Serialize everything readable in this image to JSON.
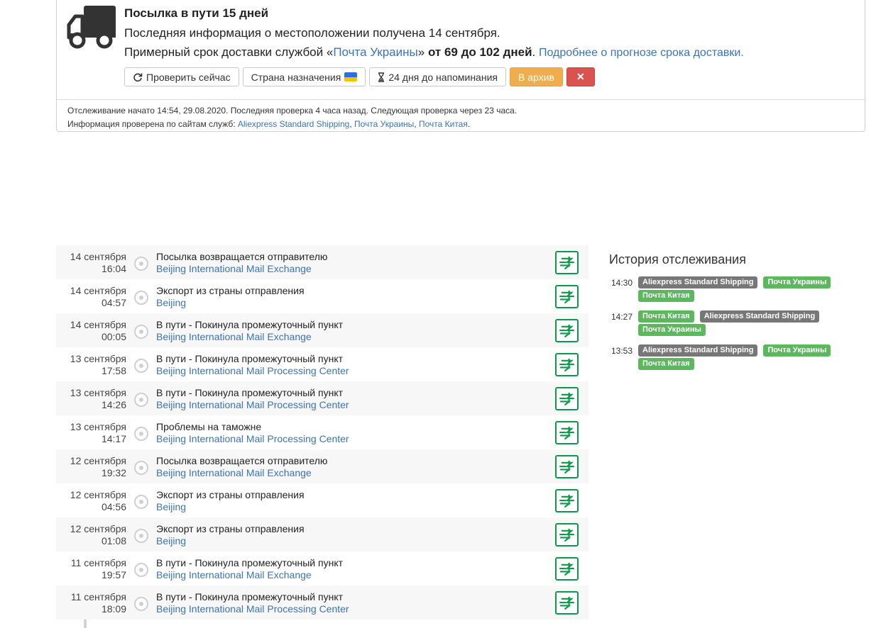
{
  "status": {
    "title": "Посылка в пути 15 дней",
    "last_info": "Последняя информация о местоположении получена 14 сентября.",
    "estimate_prefix": "Примерный срок доставки службой «",
    "estimate_service": "Почта Украины",
    "estimate_suffix": "»",
    "estimate_range": "от 69 до 102 дней",
    "estimate_link": "Подробнее о прогнозе срока доставки.",
    "buttons": {
      "check_now": "Проверить сейчас",
      "destination": "Страна назначения",
      "reminder": "24 дня до напоминания",
      "archive": "В архив",
      "remove": "✕"
    },
    "footer_line1": "Отслеживание начато 14:54, 29.08.2020. Последняя проверка 4 часа назад. Следующая проверка через 23 часа.",
    "footer_prefix": "Информация проверена по сайтам служб: ",
    "footer_services": [
      "Aliexpress Standard Shipping",
      "Почта Украины",
      "Почта Китая"
    ],
    "flag_colors": [
      "#2a6fdb",
      "#f5c400"
    ]
  },
  "timeline": [
    {
      "date": "14 сентября",
      "time": "16:04",
      "event": "Посылка возвращается отправителю",
      "place": "Beijing International Mail Exchange",
      "carrier_icon": "china-post-icon"
    },
    {
      "date": "14 сентября",
      "time": "04:57",
      "event": "Экспорт из страны отправления",
      "place": "Beijing",
      "carrier_icon": "china-post-icon"
    },
    {
      "date": "14 сентября",
      "time": "00:05",
      "event": "В пути - Покинула промежуточный пункт",
      "place": "Beijing International Mail Exchange",
      "carrier_icon": "china-post-icon"
    },
    {
      "date": "13 сентября",
      "time": "17:58",
      "event": "В пути - Покинула промежуточный пункт",
      "place": "Beijing International Mail Processing Center",
      "carrier_icon": "china-post-icon"
    },
    {
      "date": "13 сентября",
      "time": "14:26",
      "event": "В пути - Покинула промежуточный пункт",
      "place": "Beijing International Mail Processing Center",
      "carrier_icon": "china-post-icon"
    },
    {
      "date": "13 сентября",
      "time": "14:17",
      "event": "Проблемы на таможне",
      "place": "Beijing International Mail Processing Center",
      "carrier_icon": "china-post-icon"
    },
    {
      "date": "12 сентября",
      "time": "19:32",
      "event": "Посылка возвращается отправителю",
      "place": "Beijing International Mail Exchange",
      "carrier_icon": "china-post-icon"
    },
    {
      "date": "12 сентября",
      "time": "04:56",
      "event": "Экспорт из страны отправления",
      "place": "Beijing",
      "carrier_icon": "china-post-icon"
    },
    {
      "date": "12 сентября",
      "time": "01:08",
      "event": "Экспорт из страны отправления",
      "place": "Beijing",
      "carrier_icon": "china-post-icon"
    },
    {
      "date": "11 сентября",
      "time": "19:57",
      "event": "В пути - Покинула промежуточный пункт",
      "place": "Beijing International Mail Exchange",
      "carrier_icon": "china-post-icon"
    },
    {
      "date": "11 сентября",
      "time": "18:09",
      "event": "В пути - Покинула промежуточный пункт",
      "place": "Beijing International Mail Processing Center",
      "carrier_icon": "china-post-icon"
    }
  ],
  "history": {
    "title": "История отслеживания",
    "entries": [
      {
        "time": "14:30",
        "tags": [
          {
            "label": "Aliexpress Standard Shipping",
            "color": "gray"
          },
          {
            "label": "Почта Украины",
            "color": "green"
          },
          {
            "label": "Почта Китая",
            "color": "green"
          }
        ]
      },
      {
        "time": "14:27",
        "tags": [
          {
            "label": "Почта Китая",
            "color": "green"
          },
          {
            "label": "Aliexpress Standard Shipping",
            "color": "gray"
          },
          {
            "label": "Почта Украины",
            "color": "green"
          }
        ]
      },
      {
        "time": "13:53",
        "tags": [
          {
            "label": "Aliexpress Standard Shipping",
            "color": "gray"
          },
          {
            "label": "Почта Украины",
            "color": "green"
          },
          {
            "label": "Почта Китая",
            "color": "green"
          }
        ]
      }
    ]
  }
}
